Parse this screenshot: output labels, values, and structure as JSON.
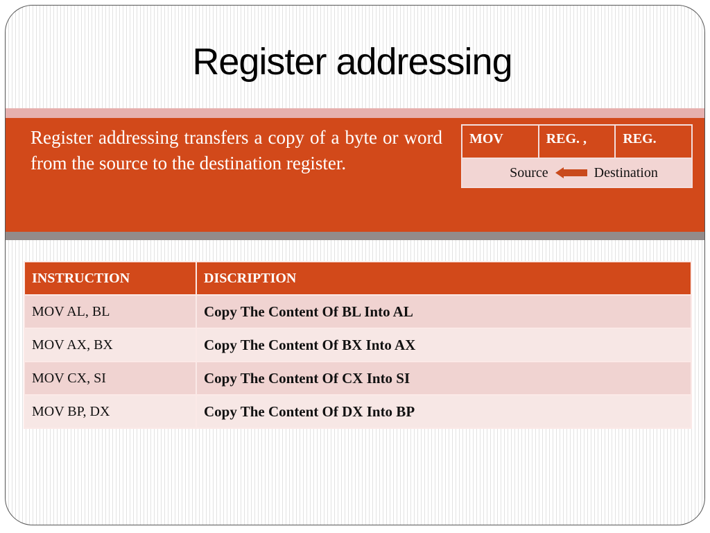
{
  "slide": {
    "title": "Register addressing",
    "intro_text": "Register addressing transfers a copy of a byte or word from the source to the destination register.",
    "syntax_box": {
      "header_cells": [
        "MOV",
        "REG. ,",
        "REG."
      ],
      "source_label": "Source",
      "destination_label": "Destination",
      "arrow_icon": "left-arrow-icon"
    },
    "table": {
      "headers": [
        "INSTRUCTION",
        "DISCRIPTION"
      ],
      "rows": [
        {
          "instruction": "MOV AL, BL",
          "description": "Copy The Content Of BL Into AL"
        },
        {
          "instruction": "MOV AX, BX",
          "description": "Copy The Content Of BX Into AX"
        },
        {
          "instruction": "MOV CX, SI",
          "description": "Copy The Content Of CX Into SI"
        },
        {
          "instruction": "MOV BP, DX",
          "description": "Copy The Content Of DX Into BP"
        }
      ]
    },
    "colors": {
      "accent": "#d2491a",
      "accent_light": "#e6b0ae",
      "row_odd": "#f0d3d1",
      "row_even": "#f7e7e5",
      "gray_band": "#938b8a"
    }
  }
}
